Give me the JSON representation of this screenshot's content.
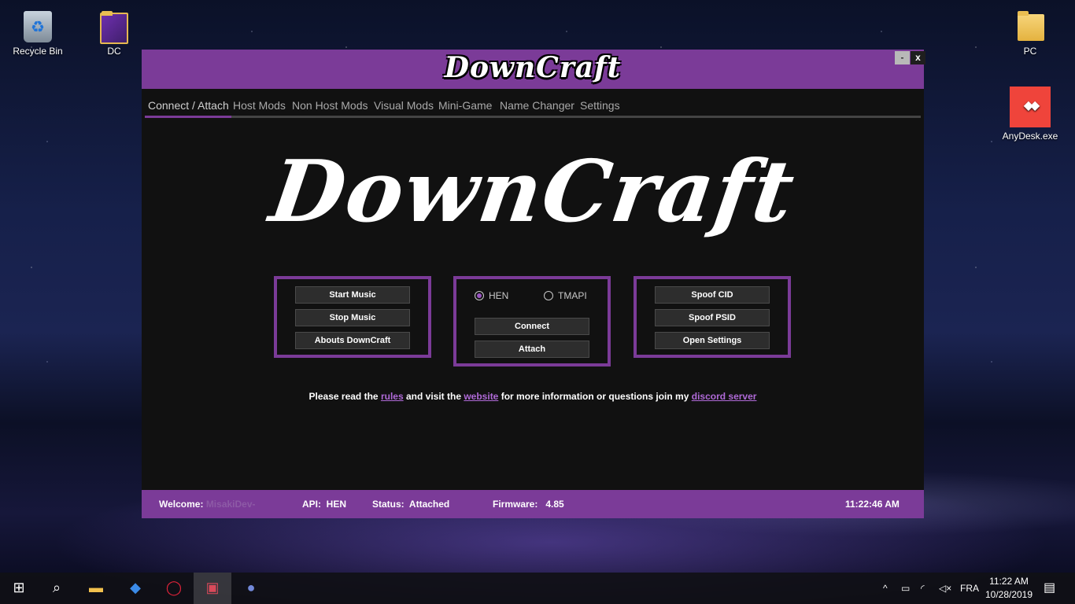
{
  "desktop": {
    "icons": [
      {
        "label": "Recycle Bin"
      },
      {
        "label": "DC"
      },
      {
        "label": "PC"
      },
      {
        "label": "AnyDesk.exe"
      }
    ]
  },
  "window": {
    "title_logo": "DownCraft",
    "minimize_label": "-",
    "close_label": "x"
  },
  "tabs": [
    {
      "label": "Connect / Attach"
    },
    {
      "label": "Host Mods"
    },
    {
      "label": "Non Host Mods"
    },
    {
      "label": "Visual Mods"
    },
    {
      "label": "Mini-Game"
    },
    {
      "label": "Name Changer"
    },
    {
      "label": "Settings"
    }
  ],
  "main": {
    "logo": "DownCraft",
    "music_box": {
      "start_music": "Start Music",
      "stop_music": "Stop Music",
      "abouts": "Abouts DownCraft"
    },
    "connect_box": {
      "radio_hen": "HEN",
      "radio_tmapi": "TMAPI",
      "selected": "HEN",
      "connect": "Connect",
      "attach": "Attach"
    },
    "spoof_box": {
      "spoof_cid": "Spoof CID",
      "spoof_psid": "Spoof PSID",
      "open_settings": "Open Settings"
    },
    "info": {
      "part1": "Please read the",
      "rules": "rules",
      "part2": "and visit the",
      "website": "website",
      "part3": "for more information or questions join my",
      "discord": "discord server"
    }
  },
  "statusbar": {
    "welcome_label": "Welcome:",
    "welcome_value": "MisakiDev-",
    "api_label": "API:",
    "api_value": "HEN",
    "status_label": "Status:",
    "status_value": "Attached",
    "firmware_label": "Firmware:",
    "firmware_value": "4.85",
    "time": "11:22:46 AM"
  },
  "taskbar": {
    "language": "FRA",
    "time": "11:22 AM",
    "date": "10/28/2019"
  },
  "colors": {
    "accent": "#7b3b98",
    "link": "#b06ad8",
    "panel_bg": "#111111"
  }
}
